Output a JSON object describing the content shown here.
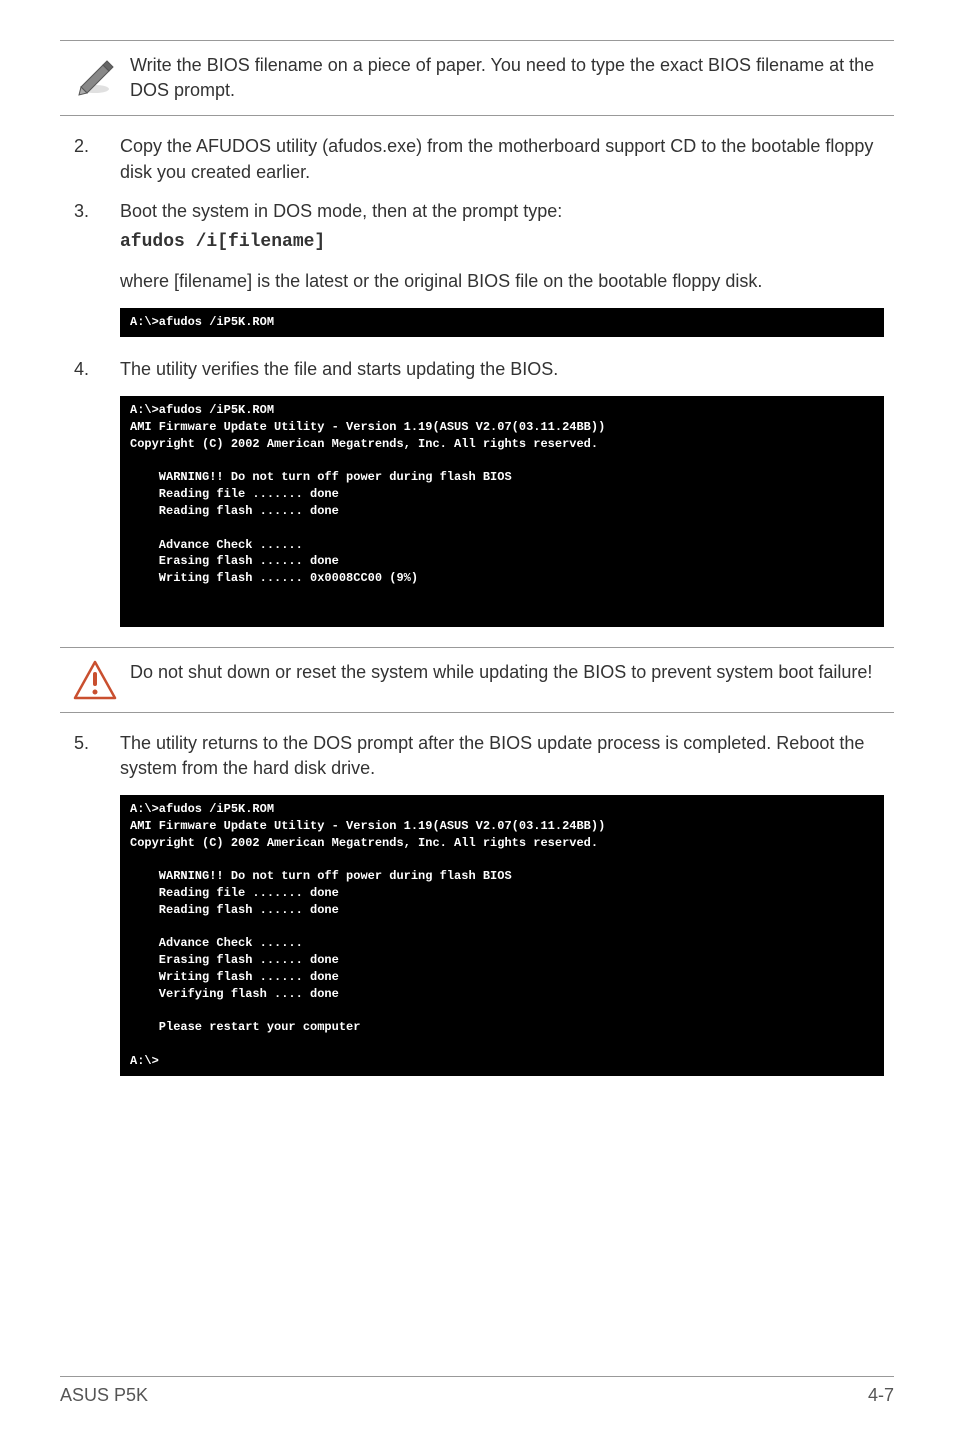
{
  "note1": {
    "text": "Write the BIOS filename on a piece of paper. You need to type the exact BIOS filename at the DOS prompt."
  },
  "step2": {
    "num": "2.",
    "text": "Copy the AFUDOS utility (afudos.exe) from the motherboard support CD to the bootable floppy disk you created earlier."
  },
  "step3": {
    "num": "3.",
    "text": "Boot the system in DOS mode, then at the prompt type:",
    "code": "afudos /i[filename]"
  },
  "step3_explain": "where [filename] is the latest or the original BIOS file on the bootable floppy disk.",
  "terminal1": "A:\\>afudos /iP5K.ROM",
  "step4": {
    "num": "4.",
    "text": "The utility verifies the file and starts updating the BIOS."
  },
  "terminal2": "A:\\>afudos /iP5K.ROM\nAMI Firmware Update Utility - Version 1.19(ASUS V2.07(03.11.24BB))\nCopyright (C) 2002 American Megatrends, Inc. All rights reserved.\n\n    WARNING!! Do not turn off power during flash BIOS\n    Reading file ....... done\n    Reading flash ...... done\n\n    Advance Check ......\n    Erasing flash ...... done\n    Writing flash ...... 0x0008CC00 (9%)\n\n\n",
  "warning": {
    "text": "Do not shut down or reset the system while updating the BIOS to prevent system boot failure!"
  },
  "step5": {
    "num": "5.",
    "text": "The utility returns to the DOS prompt after the BIOS update process is completed. Reboot the system from the hard disk drive."
  },
  "terminal3": "A:\\>afudos /iP5K.ROM\nAMI Firmware Update Utility - Version 1.19(ASUS V2.07(03.11.24BB))\nCopyright (C) 2002 American Megatrends, Inc. All rights reserved.\n\n    WARNING!! Do not turn off power during flash BIOS\n    Reading file ....... done\n    Reading flash ...... done\n\n    Advance Check ......\n    Erasing flash ...... done\n    Writing flash ...... done\n    Verifying flash .... done\n\n    Please restart your computer\n\nA:\\>",
  "footer": {
    "left": "ASUS P5K",
    "right": "4-7"
  }
}
